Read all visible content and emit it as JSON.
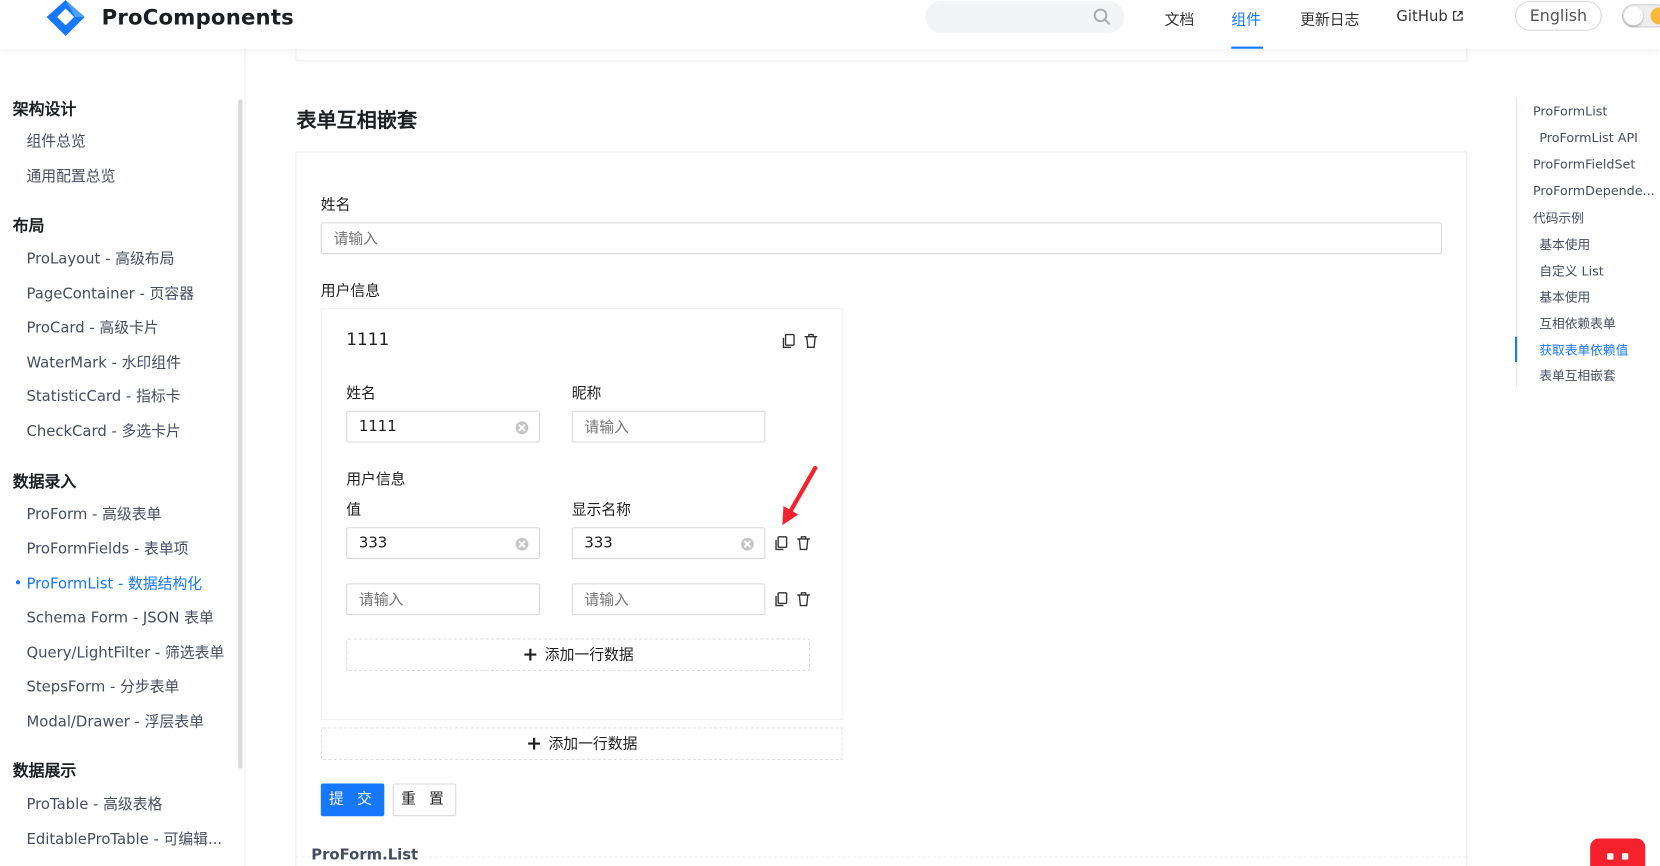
{
  "header": {
    "logo_text": "ProComponents",
    "search_placeholder": "",
    "nav": [
      "文档",
      "组件",
      "更新日志",
      "GitHub"
    ],
    "active_nav": "组件",
    "lang_button": "English"
  },
  "sidebar": {
    "groups": [
      {
        "title": "架构设计",
        "items": [
          "组件总览",
          "通用配置总览"
        ]
      },
      {
        "title": "布局",
        "items": [
          "ProLayout - 高级布局",
          "PageContainer - 页容器",
          "ProCard - 高级卡片",
          "WaterMark - 水印组件",
          "StatisticCard - 指标卡",
          "CheckCard - 多选卡片"
        ]
      },
      {
        "title": "数据录入",
        "items": [
          "ProForm - 高级表单",
          "ProFormFields - 表单项",
          "ProFormList - 数据结构化",
          "Schema Form - JSON 表单",
          "Query/LightFilter - 筛选表单",
          "StepsForm - 分步表单",
          "Modal/Drawer - 浮层表单"
        ]
      },
      {
        "title": "数据展示",
        "items": [
          "ProTable - 高级表格",
          "EditableProTable - 可编辑..."
        ]
      }
    ],
    "active_item": "ProFormList - 数据结构化"
  },
  "main": {
    "section_title": "表单互相嵌套",
    "form": {
      "name_label": "姓名",
      "name_placeholder": "请输入",
      "user_info_label": "用户信息",
      "card": {
        "title": "1111",
        "name_label": "姓名",
        "name_value": "1111",
        "nickname_label": "昵称",
        "nickname_placeholder": "请输入",
        "inner_label": "用户信息",
        "value_label": "值",
        "display_label": "显示名称",
        "rows": [
          {
            "value": "333",
            "display": "333"
          },
          {
            "value_placeholder": "请输入",
            "display_placeholder": "请输入"
          }
        ],
        "add_row": "添加一行数据"
      },
      "add_row": "添加一行数据",
      "submit": "提 交",
      "reset": "重 置"
    },
    "bottom_legend": "ProForm.List"
  },
  "toc": {
    "items": [
      "ProFormList",
      "ProFormList API",
      "ProFormFieldSet",
      "ProFormDepende...",
      "代码示例",
      "基本使用",
      "自定义 List",
      "基本使用",
      "互相依赖表单",
      "获取表单依赖值",
      "表单互相嵌套"
    ],
    "active": "获取表单依赖值"
  },
  "colors": {
    "primary": "#1677ff",
    "annotation_arrow": "#f5222d"
  }
}
